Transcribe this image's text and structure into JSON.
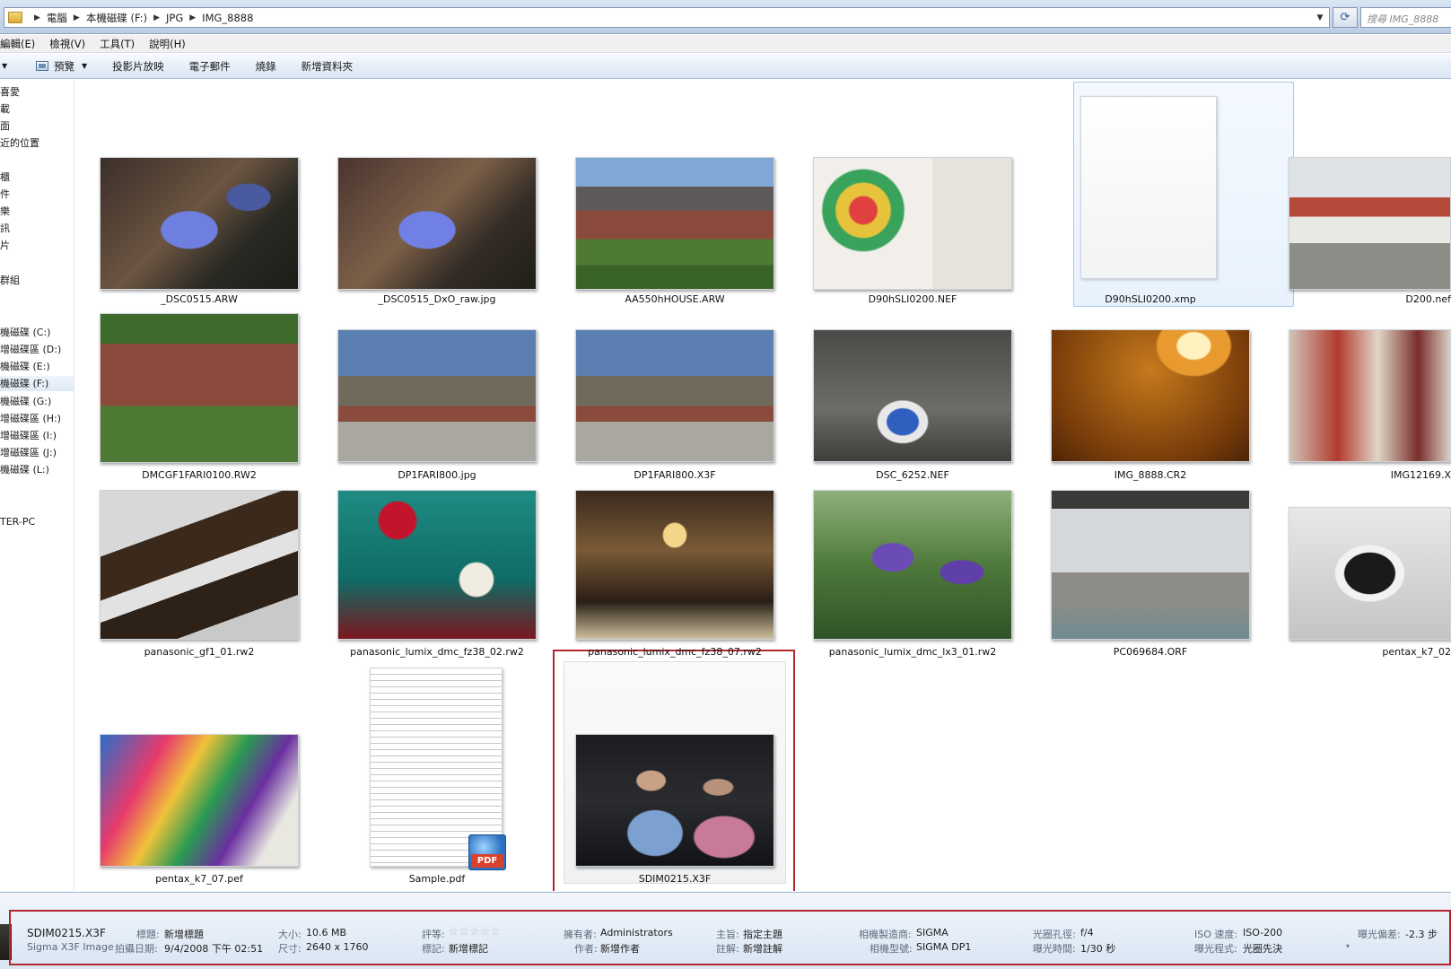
{
  "address": {
    "crumbs": [
      "電腦",
      "本機磁碟 (F:)",
      "JPG",
      "IMG_8888"
    ],
    "search_placeholder": "搜尋 IMG_8888"
  },
  "menu": [
    "編輯(E)",
    "檢視(V)",
    "工具(T)",
    "說明(H)"
  ],
  "toolbar": {
    "preview": "預覽",
    "slideshow": "投影片放映",
    "email": "電子郵件",
    "burn": "燒錄",
    "new_folder": "新增資料夾"
  },
  "nav": [
    "喜愛",
    "載",
    "面",
    "近的位置",
    "櫃",
    "件",
    "樂",
    "訊",
    "片",
    "群組",
    "機磁碟 (C:)",
    "增磁碟區 (D:)",
    "機磁碟 (E:)",
    "機磁碟 (F:)",
    "機磁碟 (G:)",
    "增磁碟區 (H:)",
    "增磁碟區 (I:)",
    "增磁碟區 (J:)",
    "機磁碟 (L:)",
    "TER-PC"
  ],
  "files": [
    "_DSC0515.ARW",
    "_DSC0515_DxO_raw.jpg",
    "AA550hHOUSE.ARW",
    "D90hSLI0200.NEF",
    "D90hSLI0200.xmp",
    "D200.nef",
    "DMCGF1FARI0100.RW2",
    "DP1FARI800.jpg",
    "DP1FARI800.X3F",
    "DSC_6252.NEF",
    "IMG_8888.CR2",
    "IMG12169.X",
    "panasonic_gf1_01.rw2",
    "panasonic_lumix_dmc_fz38_02.rw2",
    "panasonic_lumix_dmc_fz38_07.rw2",
    "panasonic_lumix_dmc_lx3_01.rw2",
    "PC069684.ORF",
    "pentax_k7_02",
    "pentax_k7_07.pef",
    "Sample.pdf",
    "SDIM0215.X3F"
  ],
  "pdf_badge": "PDF",
  "details": {
    "name": "SDIM0215.X3F",
    "type": "Sigma X3F Image",
    "title_k": "標題:",
    "title_v": "新增標題",
    "date_k": "拍攝日期:",
    "date_v": "9/4/2008 下午 02:51",
    "size_k": "大小:",
    "size_v": "10.6 MB",
    "dim_k": "尺寸:",
    "dim_v": "2640 x 1760",
    "rating_k": "評等:",
    "rating_v": "☆☆☆☆☆",
    "tags_k": "標記:",
    "tags_v": "新增標記",
    "owner_k": "擁有者:",
    "owner_v": "Administrators",
    "author_k": "作者:",
    "author_v": "新增作者",
    "subject_k": "主旨:",
    "subject_v": "指定主題",
    "comment_k": "註解:",
    "comment_v": "新增註解",
    "maker_k": "相機製造商:",
    "maker_v": "SIGMA",
    "model_k": "相機型號:",
    "model_v": "SIGMA DP1",
    "fstop_k": "光圈孔徑:",
    "fstop_v": "f/4",
    "exposure_k": "曝光時間:",
    "exposure_v": "1/30 秒",
    "iso_k": "ISO 速度:",
    "iso_v": "ISO-200",
    "program_k": "曝光程式:",
    "program_v": "光圈先決",
    "bias_k": "曝光偏差:",
    "bias_v": "-2.3 步"
  }
}
